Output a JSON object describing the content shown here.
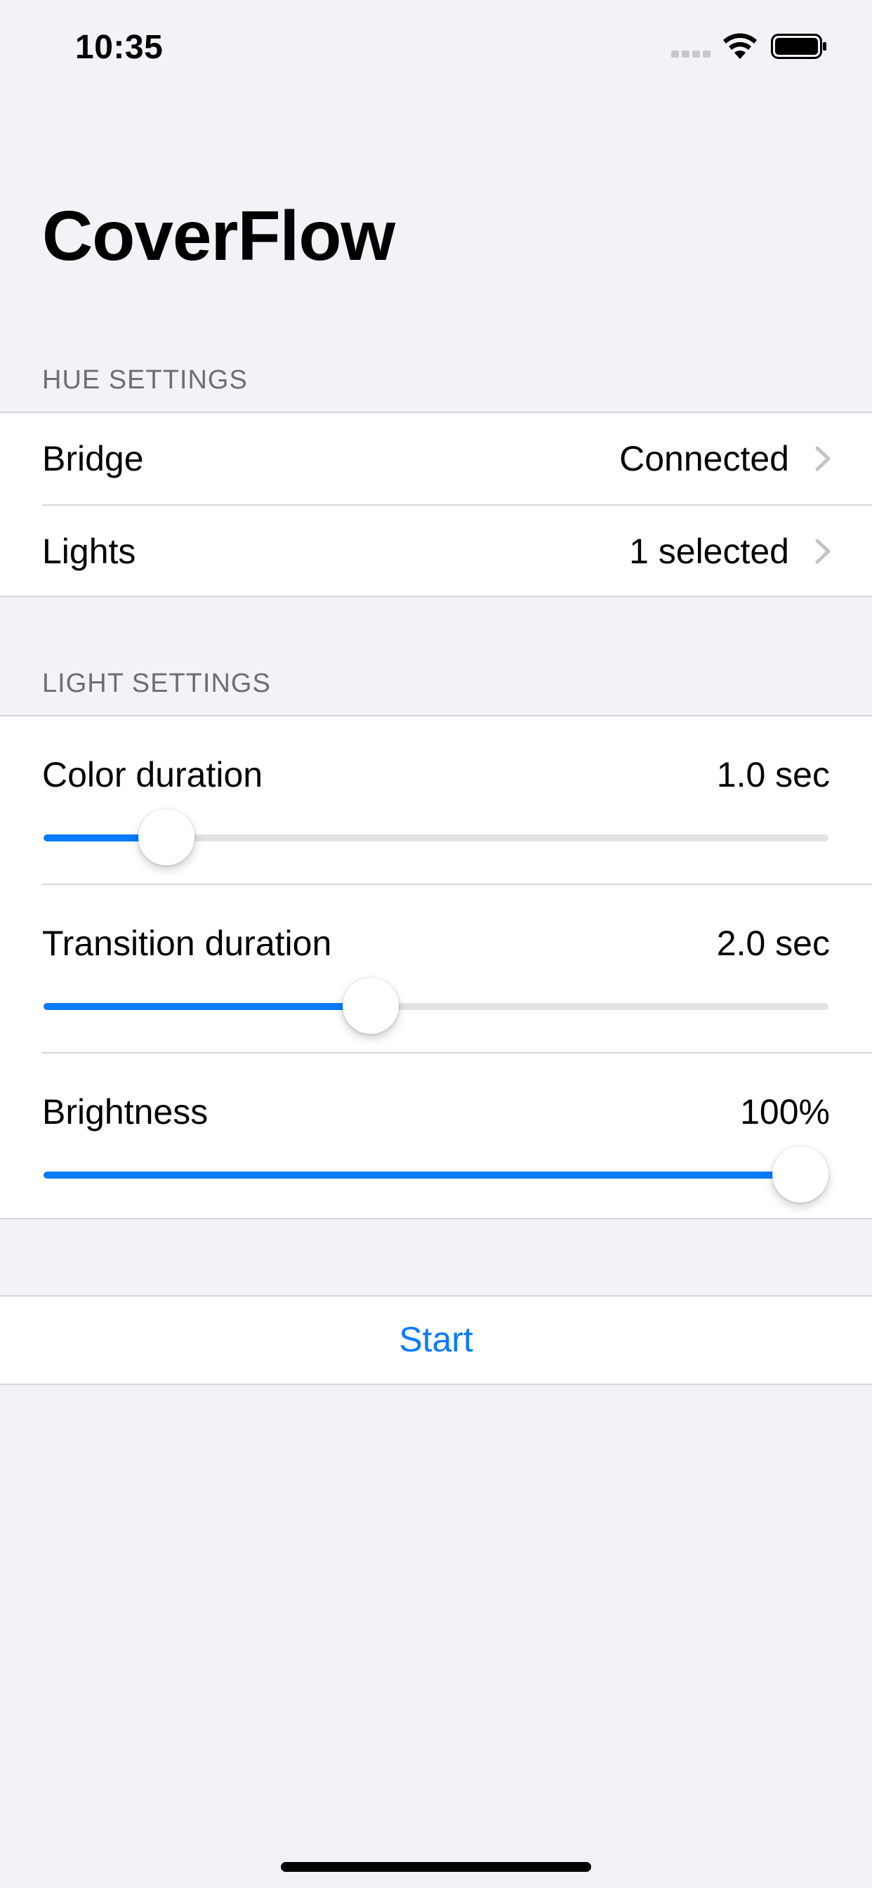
{
  "status_bar": {
    "time": "10:35",
    "icons": [
      "cellular-signal-icon",
      "wifi-icon",
      "battery-icon"
    ]
  },
  "title": "CoverFlow",
  "hue_settings": {
    "header": "HUE SETTINGS",
    "rows": [
      {
        "label": "Bridge",
        "value": "Connected",
        "icon": "chevron-right-icon"
      },
      {
        "label": "Lights",
        "value": "1 selected",
        "icon": "chevron-right-icon"
      }
    ]
  },
  "light_settings": {
    "header": "LIGHT SETTINGS",
    "sliders": [
      {
        "label": "Color duration",
        "value": "1.0 sec",
        "fraction": 0.13
      },
      {
        "label": "Transition duration",
        "value": "2.0 sec",
        "fraction": 0.41
      },
      {
        "label": "Brightness",
        "value": "100%",
        "fraction": 1.0
      }
    ]
  },
  "actions": {
    "start_label": "Start"
  },
  "colors": {
    "accent": "#0a7aff",
    "background": "#f2f2f7",
    "cell": "#ffffff",
    "secondary_text": "#6d6d72",
    "separator": "#d6d6db"
  }
}
